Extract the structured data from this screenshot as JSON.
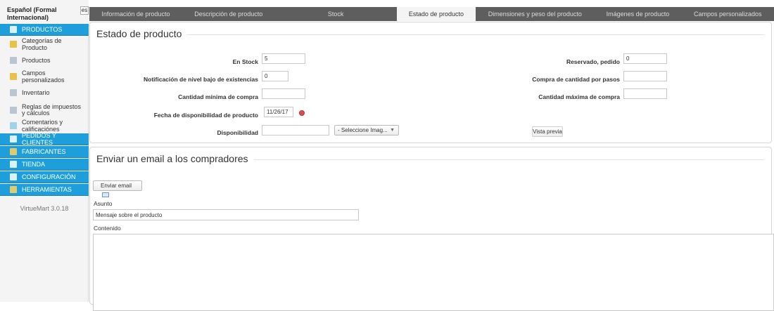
{
  "sidebar": {
    "language_label": "Español (Formal Internacional)",
    "language_code": "es",
    "sections": [
      {
        "label": "PRODUCTOS",
        "icon": "products-icon"
      },
      {
        "label": "PEDIDOS Y CLIENTES",
        "icon": "orders-icon"
      },
      {
        "label": "FABRICANTES",
        "icon": "manufacturers-icon"
      },
      {
        "label": "TIENDA",
        "icon": "store-icon"
      },
      {
        "label": "CONFIGURACIÓN",
        "icon": "config-icon"
      },
      {
        "label": "HERRAMIENTAS",
        "icon": "tools-icon"
      }
    ],
    "product_items": [
      {
        "label": "Categorías de Producto",
        "icon": "categories-icon"
      },
      {
        "label": "Productos",
        "icon": "products-list-icon"
      },
      {
        "label": "Campos personalizados",
        "icon": "custom-fields-icon"
      },
      {
        "label": "Inventario",
        "icon": "inventory-icon"
      },
      {
        "label": "Reglas de impuestos y cálculos",
        "icon": "tax-rules-icon"
      },
      {
        "label": "Comentarios y calificaciónes",
        "icon": "comments-icon"
      }
    ],
    "version": "VirtueMart 3.0.18"
  },
  "tabs": [
    {
      "label": "Información de producto",
      "active": false
    },
    {
      "label": "Descripción de producto",
      "active": false
    },
    {
      "label": "Stock",
      "active": false
    },
    {
      "label": "Estado de producto",
      "active": true
    },
    {
      "label": "Dimensiones y peso del producto",
      "active": false
    },
    {
      "label": "Imágenes de producto",
      "active": false
    },
    {
      "label": "Campos personalizados",
      "active": false
    }
  ],
  "status": {
    "title": "Estado de producto",
    "en_stock_label": "En Stock",
    "en_stock_value": "5",
    "reservado_label": "Reservado, pedido",
    "reservado_value": "0",
    "notificacion_label": "Notificación de nivel bajo de existencias",
    "notificacion_value": "0",
    "compra_pasos_label": "Compra de cantidad por pasos",
    "compra_pasos_value": "",
    "cantidad_min_label": "Cantidad mínima de compra",
    "cantidad_min_value": "",
    "cantidad_max_label": "Cantidad máxima de compra",
    "cantidad_max_value": "",
    "fecha_label": "Fecha de disponibilidad de producto",
    "fecha_value": "11/26/17",
    "disponibilidad_label": "Disponibilidad",
    "disponibilidad_value": "",
    "image_select": "- Seleccione Imag...",
    "preview_button": "Vista previa"
  },
  "email": {
    "title": "Enviar un email a los compradores",
    "send_button": "Enviar email",
    "asunto_label": "Asunto",
    "asunto_value": "Mensaje sobre el producto",
    "contenido_label": "Contenido"
  },
  "colors": {
    "accent": "#1e9fdc",
    "tab_bar": "#5e5e5e"
  }
}
